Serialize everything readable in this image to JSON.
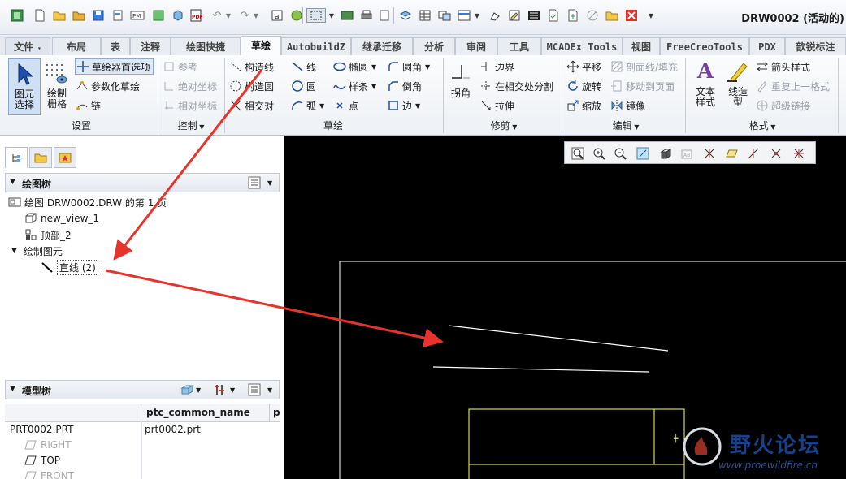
{
  "window": {
    "title": "DRW0002 (活动的)"
  },
  "tabs": [
    "文件",
    "布局",
    "表",
    "注释",
    "绘图快捷",
    "草绘",
    "AutobuildZ",
    "继承迁移",
    "分析",
    "审阅",
    "工具",
    "MCADEx Tools",
    "视图",
    "FreeCreoTools",
    "PDX",
    "歆锐标注"
  ],
  "ribbon": {
    "settings": {
      "select": "图元\n选择",
      "grid": "绘制\n栅格",
      "sketch_prefs": "草绘器首选项",
      "param_sketch": "参数化草绘",
      "chain": "链",
      "label": "设置"
    },
    "control": {
      "ref": "参考",
      "abs_coord": "绝对坐标",
      "rel_coord": "相对坐标",
      "label": "控制"
    },
    "sketch": {
      "construct_line": "构造线",
      "construct_circle": "构造圆",
      "intersect": "相交对",
      "line": "线",
      "circle": "圆",
      "arc": "弧",
      "ellipse": "椭圆",
      "spline": "样条",
      "point": "点",
      "fillet": "圆角",
      "chamfer": "倒角",
      "edge": "边",
      "label": "草绘"
    },
    "trim": {
      "corner": "拐角",
      "boundary": "边界",
      "divide": "在相交处分割",
      "stretch": "拉伸",
      "label": "修剪"
    },
    "edit": {
      "translate": "平移",
      "rotate": "旋转",
      "scale": "缩放",
      "mirror": "镜像",
      "hatch": "剖面线/填充",
      "move_to_page": "移动到页面",
      "label": "编辑"
    },
    "format": {
      "text_style": "文本\n样式",
      "line_style": "线造\n型",
      "arrow_style": "箭头样式",
      "repeat_format": "重复上一格式",
      "hyperlink": "超级链接",
      "label": "格式"
    }
  },
  "drawing_tree": {
    "title": "绘图树",
    "items": [
      "绘图 DRW0002.DRW 的第 1 页",
      "new_view_1",
      "顶部_2",
      "绘制图元",
      "直线 (2)"
    ]
  },
  "model_tree": {
    "title": "模型树",
    "columns": [
      "",
      "ptc_common_name",
      "p"
    ],
    "rows": [
      {
        "name": "PRT0002.PRT",
        "common": "prt0002.prt"
      },
      {
        "name": "RIGHT",
        "common": ""
      },
      {
        "name": "TOP",
        "common": ""
      },
      {
        "name": "FRONT",
        "common": ""
      }
    ]
  },
  "watermark": {
    "text": "野火论坛",
    "url": "www.proewildfire.cn"
  },
  "colors": {
    "arrow": "#e8322c",
    "canvas": "#000000",
    "drawing_line": "#ffffff",
    "view_border": "#ffff66"
  }
}
